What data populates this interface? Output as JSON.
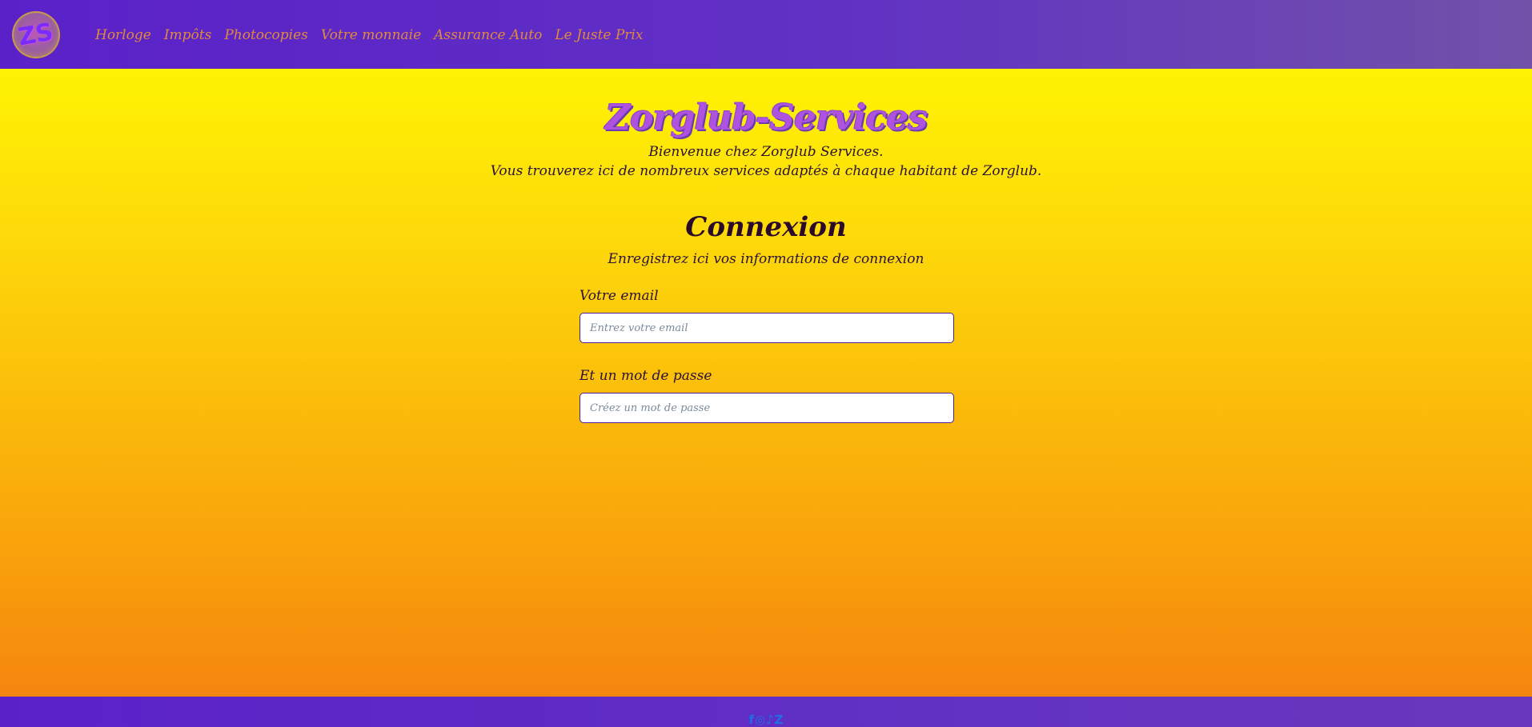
{
  "navbar": {
    "logo_letter": "ZS",
    "links": [
      "Horloge",
      "Impôts",
      "Photocopies",
      "Votre monnaie",
      "Assurance Auto",
      "Le Juste Prix"
    ]
  },
  "hero": {
    "brand": "Zorglub-Services",
    "welcome_line1": "Bienvenue chez Zorglub Services.",
    "welcome_line2": "Vous trouverez ici de nombreux services adaptés à chaque habitant de Zorglub."
  },
  "login": {
    "title": "Connexion",
    "subtitle": "Enregistrez ici vos informations de connexion",
    "email_label": "Votre email",
    "email_placeholder": "Entrez votre email",
    "password_label": "Et un mot de passe",
    "password_placeholder": "Créez un mot de passe"
  },
  "footer": {
    "social": [
      "facebook-icon",
      "instagram-icon",
      "tiktok-icon",
      "z-icon"
    ],
    "social_glyphs": [
      "f",
      "◎",
      "♪",
      "Z"
    ]
  },
  "colors": {
    "nav_bg": "#5a21c8",
    "nav_link": "#e08a3e",
    "brand": "#b052e0",
    "gradient_top": "#ffff00",
    "gradient_bottom": "#f47f10",
    "social_icon": "#1e6ee8"
  }
}
